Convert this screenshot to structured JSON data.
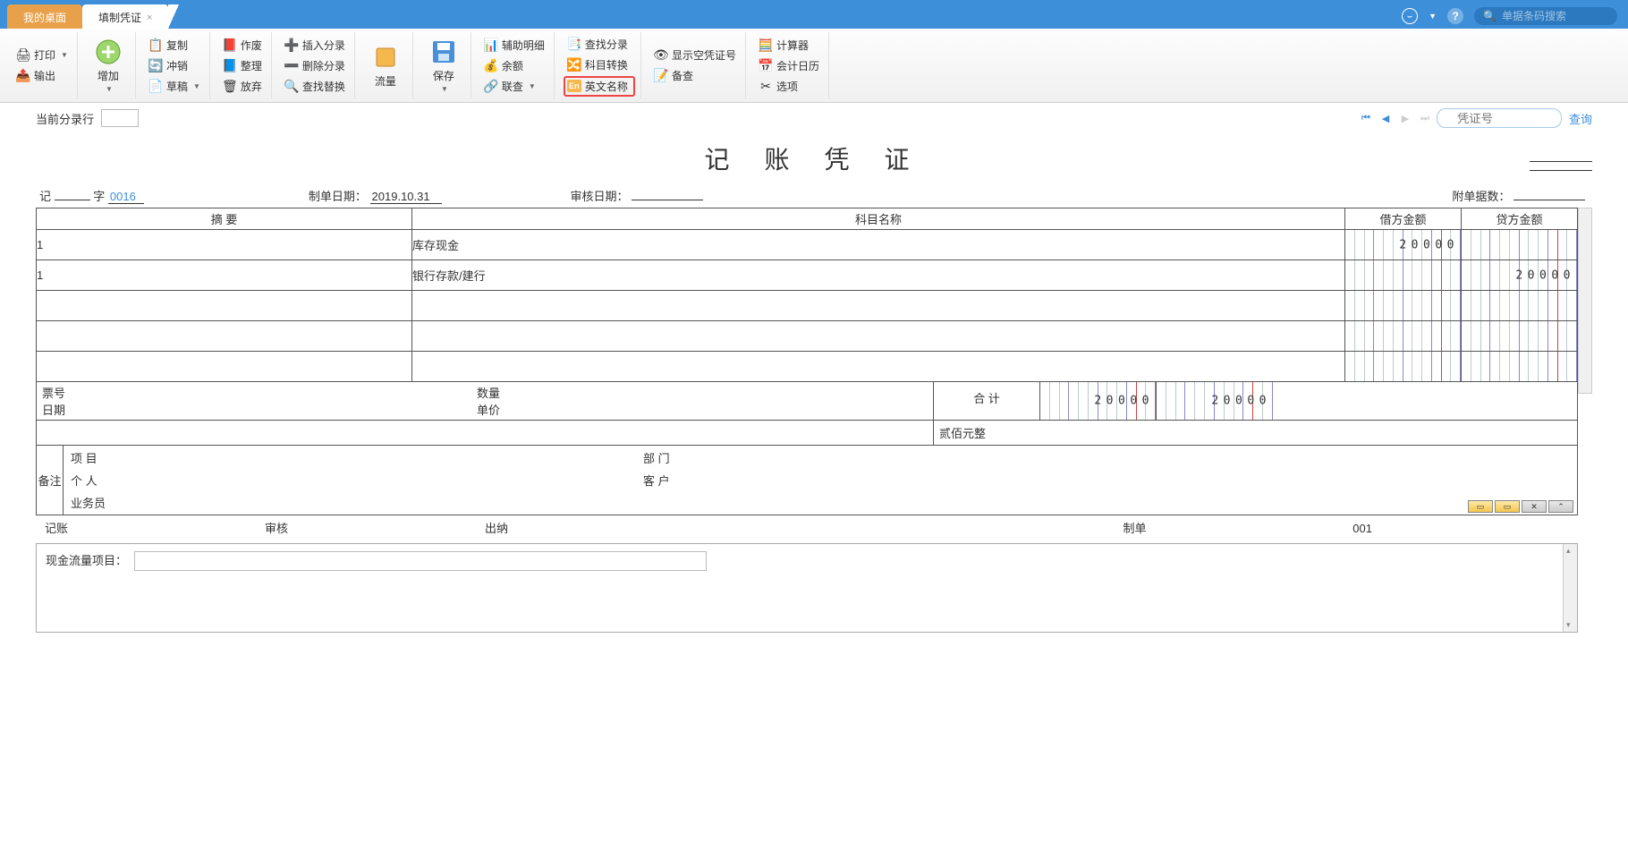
{
  "tabs": {
    "desktop": "我的桌面",
    "current": "填制凭证"
  },
  "search": {
    "placeholder": "单据条码搜索"
  },
  "ribbon": {
    "print": "打印",
    "export": "输出",
    "add": "增加",
    "copy": "复制",
    "offset": "冲销",
    "draft": "草稿",
    "invalidate": "作废",
    "tidy": "整理",
    "abandon": "放弃",
    "insertEntry": "插入分录",
    "deleteEntry": "删除分录",
    "findReplace": "查找替换",
    "flow": "流量",
    "save": "保存",
    "auxDetail": "辅助明细",
    "balance": "余额",
    "linkQuery": "联查",
    "findEntry": "查找分录",
    "subjectConvert": "科目转换",
    "englishName": "英文名称",
    "showEmpty": "显示空凭证号",
    "calculator": "计算器",
    "calendar": "会计日历",
    "options": "选项"
  },
  "subbar": {
    "label": "当前分录行",
    "value": "",
    "voucherNoPlaceholder": "凭证号",
    "query": "查询"
  },
  "doc": {
    "title": "记 账 凭 证",
    "recordChar": "记",
    "charLabel": "字",
    "number": "0016",
    "makeDateLabel": "制单日期：",
    "makeDate": "2019.10.31",
    "auditDateLabel": "审核日期：",
    "auditDate": "",
    "attachLabel": "附单据数：",
    "attachCount": ""
  },
  "columns": {
    "summary": "摘 要",
    "subject": "科目名称",
    "debit": "借方金额",
    "credit": "贷方金额"
  },
  "rows": [
    {
      "summary": "1",
      "subject": "库存现金",
      "debit": "20000",
      "credit": ""
    },
    {
      "summary": "1",
      "subject": "银行存款/建行",
      "debit": "",
      "credit": "20000"
    },
    {
      "summary": "",
      "subject": "",
      "debit": "",
      "credit": ""
    },
    {
      "summary": "",
      "subject": "",
      "debit": "",
      "credit": ""
    },
    {
      "summary": "",
      "subject": "",
      "debit": "",
      "credit": ""
    }
  ],
  "info": {
    "billNo": "票号",
    "date": "日期",
    "qty": "数量",
    "price": "单价",
    "totalLabel": "合 计",
    "totalDebit": "20000",
    "totalCredit": "20000",
    "amountWords": "贰佰元整"
  },
  "remark": {
    "label": "备注",
    "project": "项 目",
    "dept": "部 门",
    "person": "个 人",
    "customer": "客 户",
    "salesman": "业务员"
  },
  "sign": {
    "bookkeeper": "记账",
    "auditor": "审核",
    "cashier": "出纳",
    "maker": "制单",
    "makerNo": "001"
  },
  "cashflow": {
    "label": "现金流量项目：",
    "value": ""
  }
}
